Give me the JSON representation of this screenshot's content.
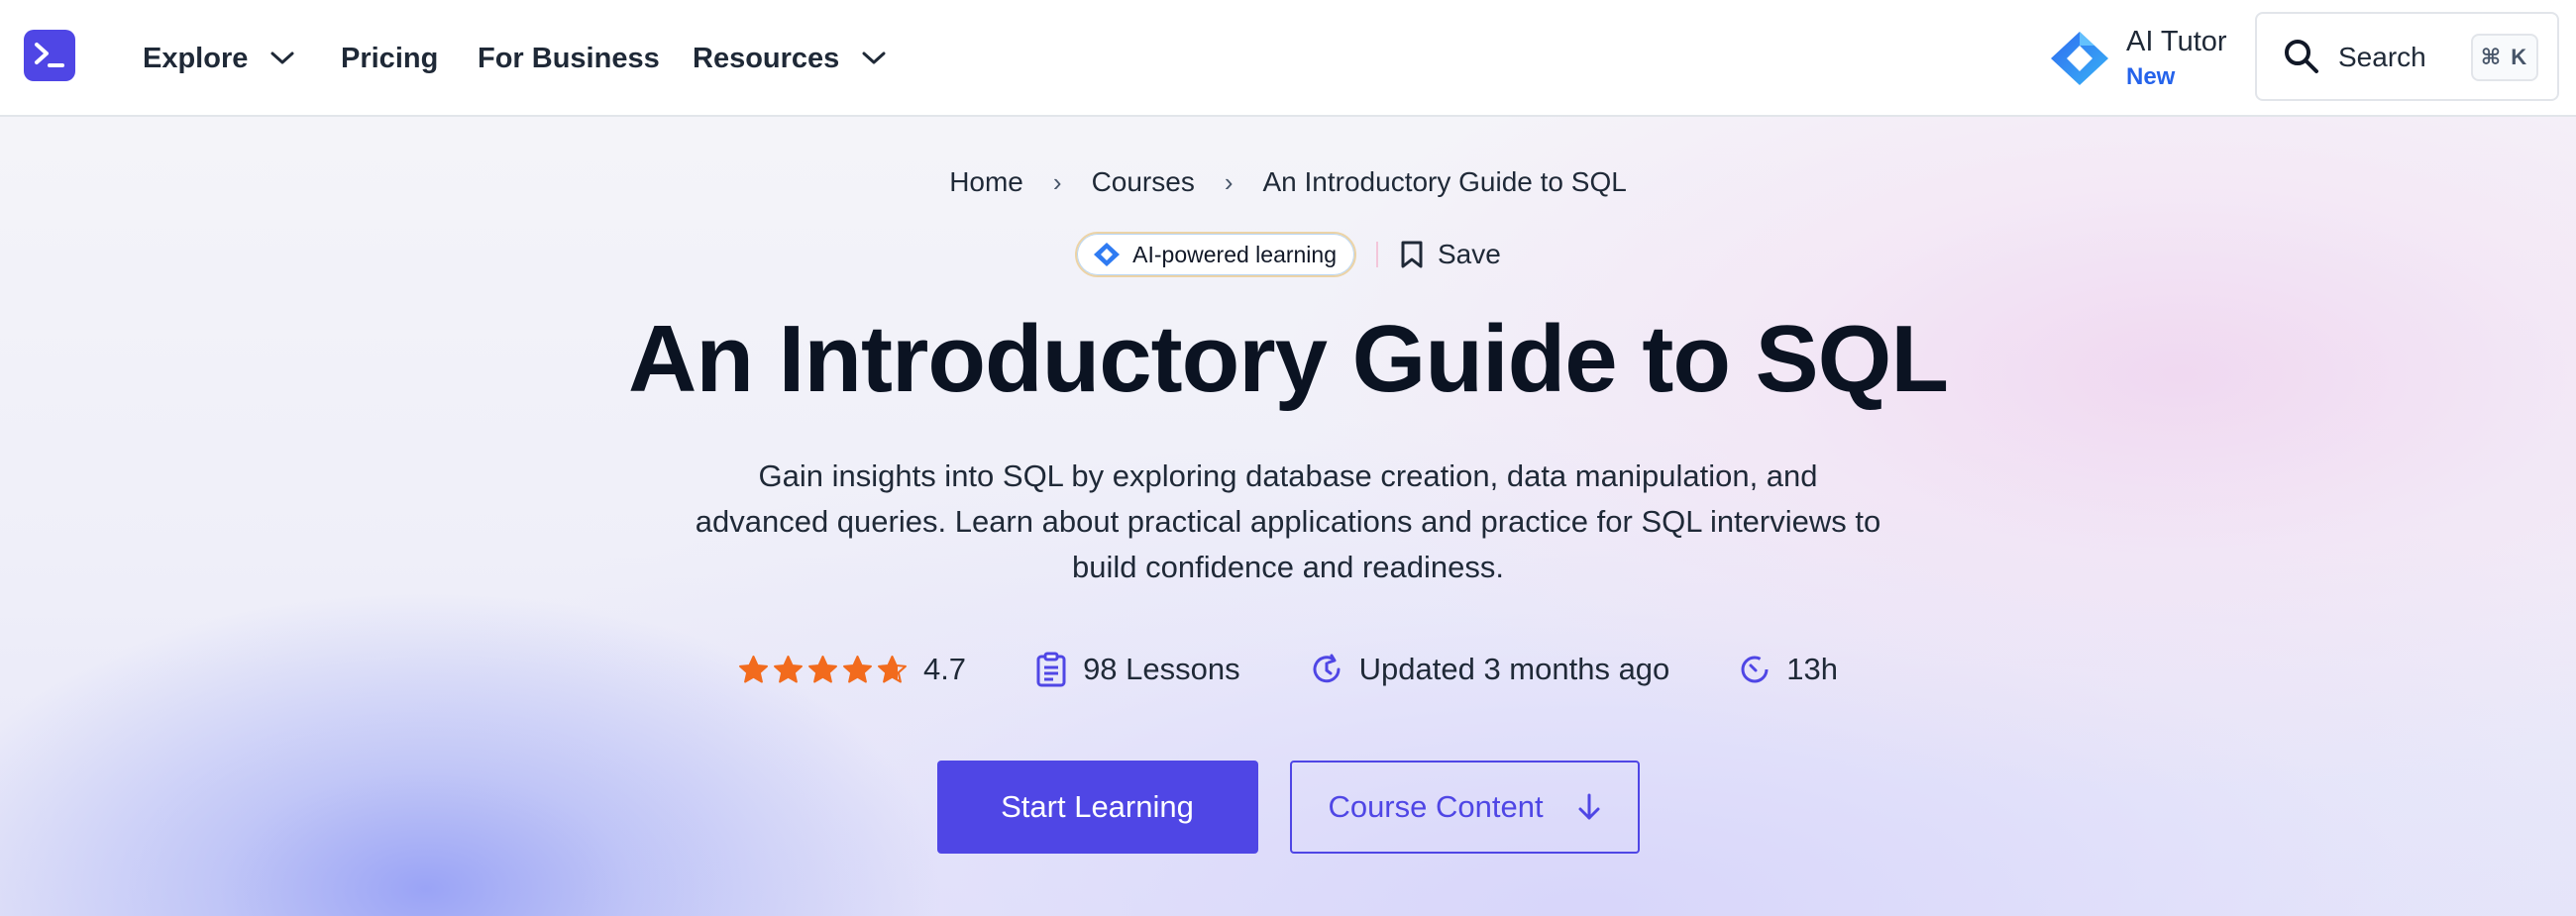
{
  "nav": {
    "items": [
      {
        "label": "Explore",
        "has_dropdown": true
      },
      {
        "label": "Pricing",
        "has_dropdown": false
      },
      {
        "label": "For Business",
        "has_dropdown": false
      },
      {
        "label": "Resources",
        "has_dropdown": true
      }
    ],
    "ai_tutor": {
      "label": "AI Tutor",
      "badge": "New"
    },
    "search": {
      "label": "Search",
      "shortcut": "⌘ K"
    }
  },
  "breadcrumb": {
    "items": [
      "Home",
      "Courses",
      "An Introductory Guide to SQL"
    ]
  },
  "badge": {
    "label": "AI-powered learning"
  },
  "save": {
    "label": "Save"
  },
  "course": {
    "title": "An Introductory Guide to SQL",
    "description": "Gain insights into SQL by exploring database creation, data manipulation, and advanced queries. Learn about practical applications and practice for SQL interviews to build confidence and readiness.",
    "rating": "4.7",
    "rating_value": 4.7,
    "rating_max": 5,
    "lessons": "98 Lessons",
    "updated": "Updated 3 months ago",
    "duration": "13h"
  },
  "actions": {
    "start": "Start Learning",
    "content": "Course Content"
  },
  "colors": {
    "primary": "#4f46e5",
    "star": "#f26b1d",
    "ai_blue": "#2563eb"
  }
}
